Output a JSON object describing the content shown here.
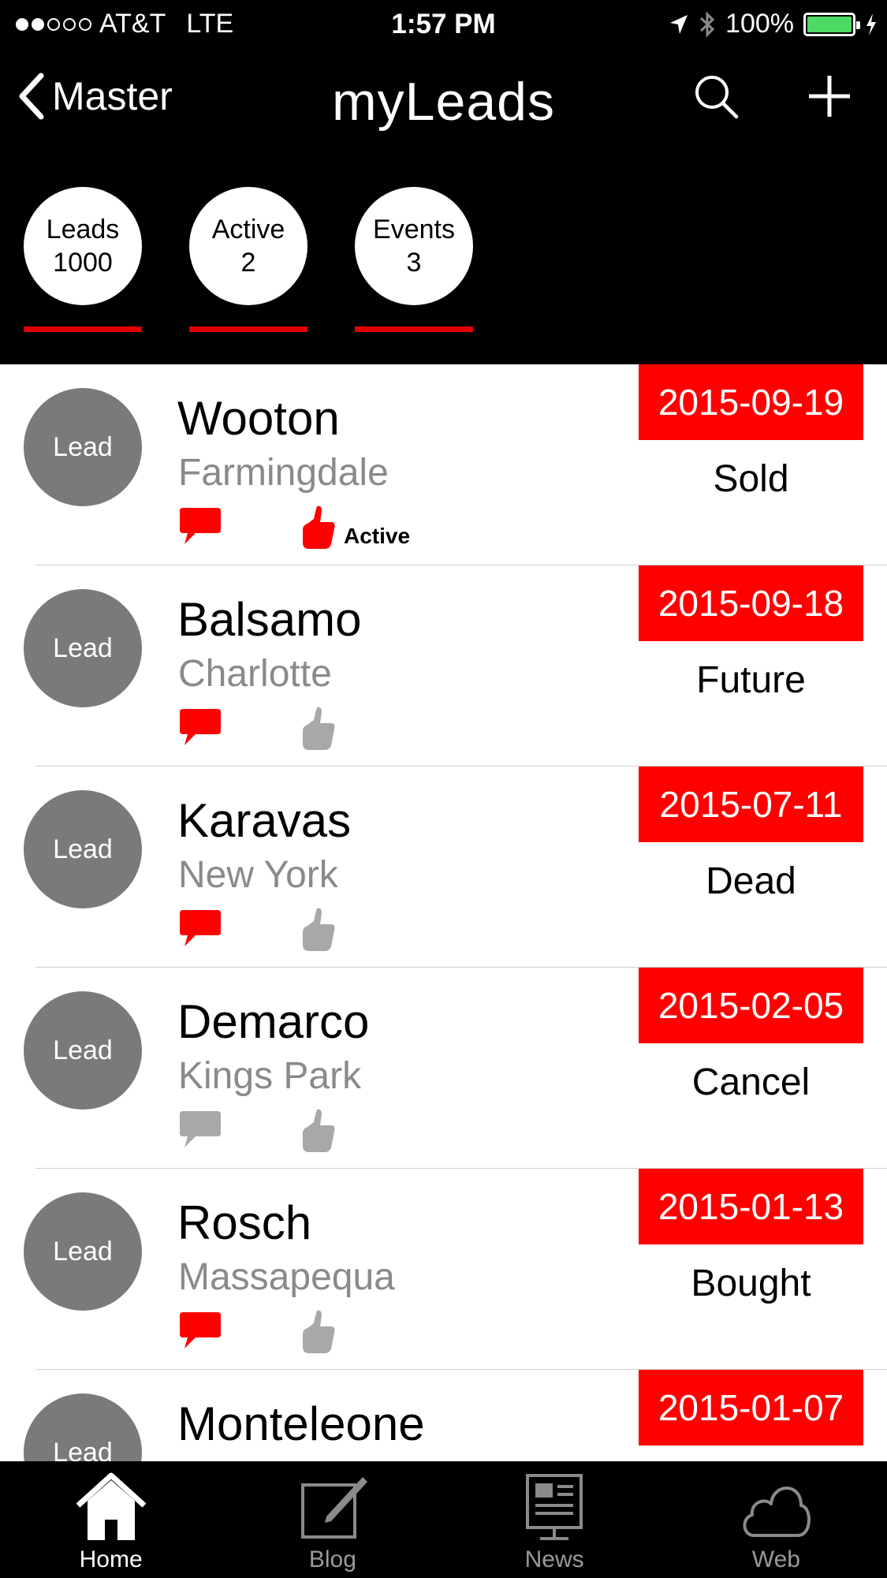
{
  "status_bar": {
    "signal_dots_filled": 2,
    "signal_dots_total": 5,
    "carrier": "AT&T",
    "network": "LTE",
    "time": "1:57 PM",
    "battery": "100%",
    "battery_level": 1.0,
    "battery_color": "#4cd964"
  },
  "nav": {
    "back_label": "Master",
    "title": "myLeads"
  },
  "filters": [
    {
      "label": "Leads",
      "count": "1000"
    },
    {
      "label": "Active",
      "count": "2"
    },
    {
      "label": "Events",
      "count": "3"
    }
  ],
  "leads": [
    {
      "avatar": "Lead",
      "name": "Wooton",
      "city": "Farmingdale",
      "date": "2015-09-19",
      "status": "Sold",
      "comment_active": true,
      "like_active": true,
      "like_label": "Active"
    },
    {
      "avatar": "Lead",
      "name": "Balsamo",
      "city": "Charlotte",
      "date": "2015-09-18",
      "status": "Future",
      "comment_active": true,
      "like_active": false
    },
    {
      "avatar": "Lead",
      "name": "Karavas",
      "city": "New York",
      "date": "2015-07-11",
      "status": "Dead",
      "comment_active": true,
      "like_active": false
    },
    {
      "avatar": "Lead",
      "name": "Demarco",
      "city": "Kings Park",
      "date": "2015-02-05",
      "status": "Cancel",
      "comment_active": false,
      "like_active": false
    },
    {
      "avatar": "Lead",
      "name": "Rosch",
      "city": "Massapequa",
      "date": "2015-01-13",
      "status": "Bought",
      "comment_active": true,
      "like_active": false
    },
    {
      "avatar": "Lead",
      "name": "Monteleone",
      "city": "",
      "date": "2015-01-07",
      "status": "",
      "comment_active": true,
      "like_active": false
    }
  ],
  "tabs": [
    {
      "label": "Home",
      "icon": "home-icon",
      "selected": true
    },
    {
      "label": "Blog",
      "icon": "blog-icon",
      "selected": false
    },
    {
      "label": "News",
      "icon": "news-icon",
      "selected": false
    },
    {
      "label": "Web",
      "icon": "cloud-icon",
      "selected": false
    }
  ],
  "colors": {
    "accent_red": "#ff0000",
    "underline_red": "#e00000",
    "inactive_gray": "#a8a8a8",
    "avatar_gray": "#7a7a7a"
  }
}
